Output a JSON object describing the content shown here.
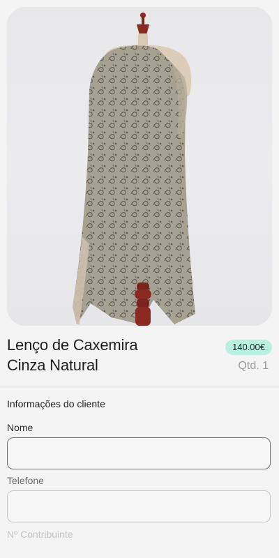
{
  "product": {
    "image_alt": "Lenço de Caxemira Cinza Natural on mannequin",
    "title_line1": "Lenço de Caxemira",
    "title_line2": "Cinza Natural",
    "price": "140.00€",
    "quantity": "Qtd. 1"
  },
  "customer_form": {
    "section_title": "Informações do cliente",
    "fields": [
      {
        "label": "Nome",
        "value": "",
        "placeholder": ""
      },
      {
        "label": "Telefone",
        "value": "",
        "placeholder": ""
      },
      {
        "label": "Nº Contribuinte",
        "value": "",
        "placeholder": ""
      }
    ]
  },
  "colors": {
    "background": "#f4f4f4",
    "price_badge": "#b9f1e1",
    "scarf": "#a9a294",
    "scarf_pattern": "#5a5a50",
    "mannequin_wood": "#8a2a22",
    "mannequin_body": "#dccdb8"
  }
}
